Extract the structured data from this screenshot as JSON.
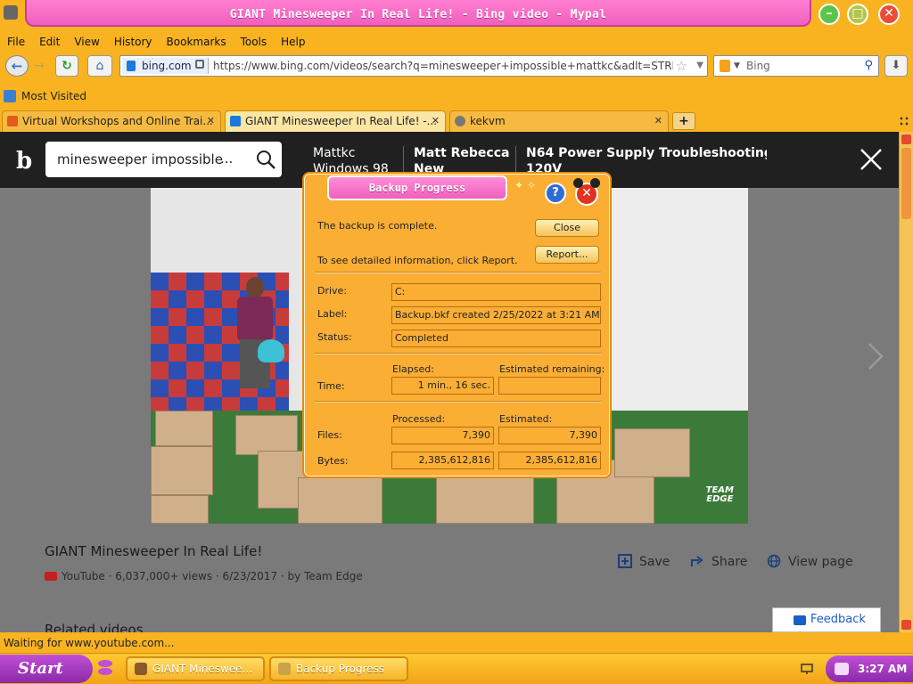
{
  "window": {
    "title": "GIANT Minesweeper In Real Life! - Bing video - Mypal",
    "min_glyph": "–",
    "max_glyph": "□",
    "close_glyph": "✕"
  },
  "menu": [
    "File",
    "Edit",
    "View",
    "History",
    "Bookmarks",
    "Tools",
    "Help"
  ],
  "nav": {
    "site_identity": "bing.com",
    "url": "https://www.bing.com/videos/search?q=minesweeper+impossible+mattkc&adlt=STRICT",
    "search_placeholder": "Bing",
    "back_glyph": "←",
    "forward_glyph": "→",
    "reload_glyph": "↻",
    "home_glyph": "⌂",
    "download_glyph": "⬇",
    "star_glyph": "☆",
    "drop_glyph": "▼",
    "search_glyph": "⚲"
  },
  "bookmarks": {
    "most_visited": "Most Visited"
  },
  "tabs": [
    {
      "label": "Virtual Workshops and Online Trai...",
      "close": "✕",
      "color": "#e25a1c"
    },
    {
      "label": "GIANT Minesweeper In Real Life! -...",
      "close": "✕",
      "color": "#1a7ad8"
    },
    {
      "label": "kekvm",
      "close": "✕",
      "color": "#777777"
    }
  ],
  "new_tab_glyph": "+",
  "bing": {
    "query": "minesweeper impossible",
    "ellipsis": "...",
    "suggestions": [
      {
        "line1": "Mattkc",
        "line2": "Windows 98"
      },
      {
        "line1": "Matt Rebecca",
        "line2": "New"
      },
      {
        "line1": "N64 Power Supply Troubleshooting",
        "line2": "120V"
      }
    ],
    "watermark_line1": "TEAM",
    "watermark_line2": "EDGE"
  },
  "video_info": {
    "title": "GIANT Minesweeper In Real Life!",
    "source": "YouTube",
    "meta": "· 6,037,000+ views · 6/23/2017 · by Team Edge",
    "actions": {
      "save": "Save",
      "share": "Share",
      "view_page": "View page"
    },
    "related": "Related videos",
    "feedback": "Feedback"
  },
  "status": "Waiting for www.youtube.com...",
  "taskbar": {
    "start": "Start",
    "tasks": [
      "GIANT Minesweе...",
      "Backup Progress"
    ],
    "clock": "3:27 AM"
  },
  "dialog": {
    "title": "Backup Progress",
    "help_glyph": "?",
    "close_glyph": "✕",
    "message": "The backup is complete.",
    "report_hint": "To see detailed information, click Report.",
    "close_label": "Close",
    "report_label": "Report...",
    "drive_label": "Drive:",
    "drive_value": "C:",
    "label_label": "Label:",
    "label_value": "Backup.bkf created 2/25/2022 at 3:21 AM",
    "status_label": "Status:",
    "status_value": "Completed",
    "elapsed_header": "Elapsed:",
    "remaining_header": "Estimated remaining:",
    "time_label": "Time:",
    "elapsed_value": "1 min., 16 sec.",
    "remaining_value": "",
    "processed_header": "Processed:",
    "estimated_header": "Estimated:",
    "files_label": "Files:",
    "files_processed": "7,390",
    "files_estimated": "7,390",
    "bytes_label": "Bytes:",
    "bytes_processed": "2,385,612,816",
    "bytes_estimated": "2,385,612,816"
  }
}
